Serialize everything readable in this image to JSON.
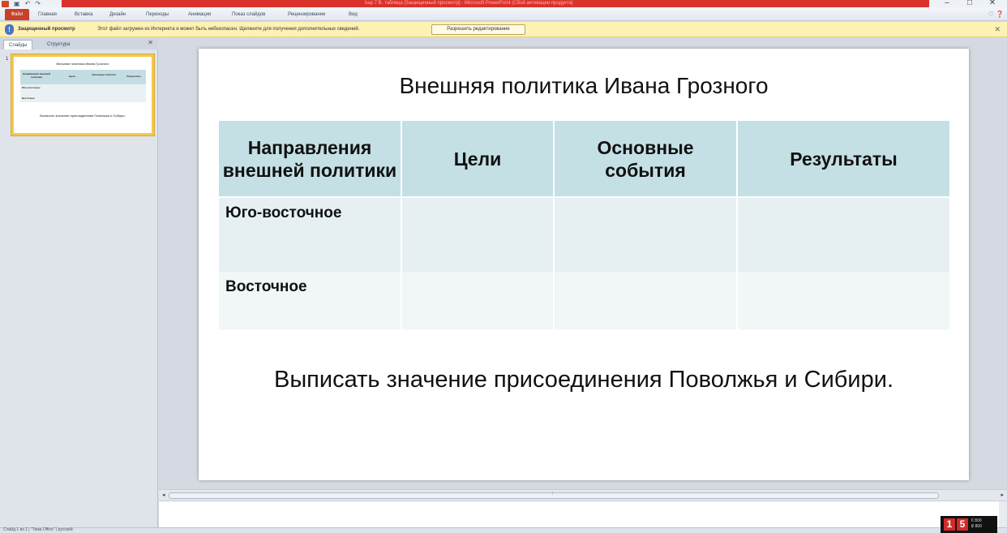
{
  "window": {
    "title": "bap 7 B. таблица [Защищенный просмотр] - Microsoft PowerPoint (Сбой активации продукта)",
    "minimize": "–",
    "maximize": "□",
    "close": "✕"
  },
  "ribbon": {
    "file_tab": "Файл",
    "tabs": [
      "Главная",
      "Вставка",
      "Дизайн",
      "Переходы",
      "Анимация",
      "Показ слайдов",
      "Рецензирование",
      "Вид"
    ]
  },
  "protected_view": {
    "title": "Защищенный просмотр",
    "message": "Этот файл загружен из Интернета и может быть небезопасен. Щелкните для получения дополнительных сведений.",
    "button": "Разрешить редактирование"
  },
  "left_panel": {
    "tab_slides": "Слайды",
    "tab_outline": "Структура",
    "slide_number": "1"
  },
  "slide": {
    "title": "Внешняя политика Ивана Грозного",
    "table": {
      "headers": [
        "Направления внешней политики",
        "Цели",
        "Основные события",
        "Результаты"
      ],
      "rows": [
        [
          "Юго-восточное",
          "",
          "",
          ""
        ],
        [
          "Восточное",
          "",
          "",
          ""
        ]
      ]
    },
    "footer": "Выписать значение присоединения Поволжья и Сибири."
  },
  "status_bar": {
    "text": "Слайд 1 из 1 | \"Тема Office\" | русский"
  },
  "tv_logo": {
    "digit1": "1",
    "digit2": "5",
    "info": "€ 800\n₽ 800"
  },
  "icon_names": [
    "powerpoint-app-icon",
    "save-icon",
    "undo-icon",
    "redo-icon",
    "shield-icon",
    "close-icon",
    "help-icon"
  ]
}
